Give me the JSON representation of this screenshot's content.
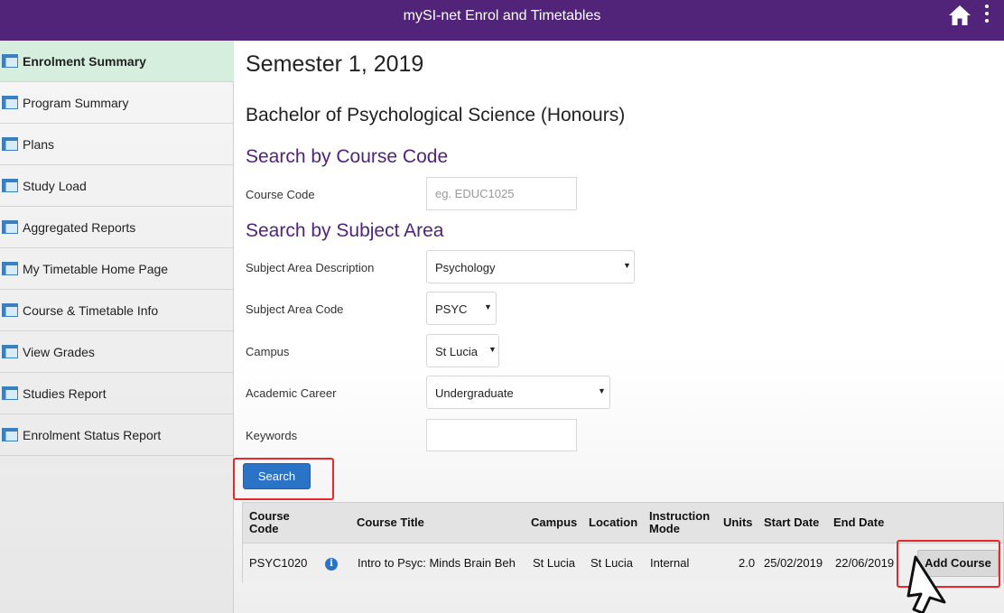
{
  "app": {
    "title": "mySI-net Enrol and Timetables",
    "accent_color": "#51247a",
    "icons": {
      "home": "home-icon",
      "menu": "more-vertical-icon"
    }
  },
  "sidebar": {
    "items": [
      {
        "label": "Enrolment Summary",
        "active": true
      },
      {
        "label": "Program Summary"
      },
      {
        "label": "Plans"
      },
      {
        "label": "Study Load"
      },
      {
        "label": "Aggregated Reports"
      },
      {
        "label": "My Timetable Home Page"
      },
      {
        "label": "Course & Timetable Info"
      },
      {
        "label": "View Grades"
      },
      {
        "label": "Studies Report"
      },
      {
        "label": "Enrolment Status Report"
      }
    ]
  },
  "main": {
    "semester": "Semester 1, 2019",
    "program": "Bachelor of Psychological Science (Honours)",
    "search_code_heading": "Search by Course Code",
    "course_code_label": "Course Code",
    "course_code_placeholder": "eg. EDUC1025",
    "course_code_value": "",
    "search_area_heading": "Search by Subject Area",
    "subject_area_desc_label": "Subject Area Description",
    "subject_area_desc_value": "Psychology",
    "subject_area_code_label": "Subject Area Code",
    "subject_area_code_value": "PSYC",
    "campus_label": "Campus",
    "campus_value": "St Lucia",
    "career_label": "Academic Career",
    "career_value": "Undergraduate",
    "keywords_label": "Keywords",
    "keywords_value": "",
    "search_button": "Search"
  },
  "results": {
    "headers": {
      "course_code_1": "Course",
      "course_code_2": "Code",
      "course_title": "Course Title",
      "campus": "Campus",
      "location": "Location",
      "mode_1": "Instruction",
      "mode_2": "Mode",
      "units": "Units",
      "start_date": "Start Date",
      "end_date": "End Date"
    },
    "rows": [
      {
        "course_code": "PSYC1020",
        "course_title": "Intro to Psyc: Minds Brain Beh",
        "campus": "St Lucia",
        "location": "St Lucia",
        "mode": "Internal",
        "units": "2.0",
        "start_date": "25/02/2019",
        "end_date": "22/06/2019",
        "action": "Add Course"
      }
    ]
  }
}
